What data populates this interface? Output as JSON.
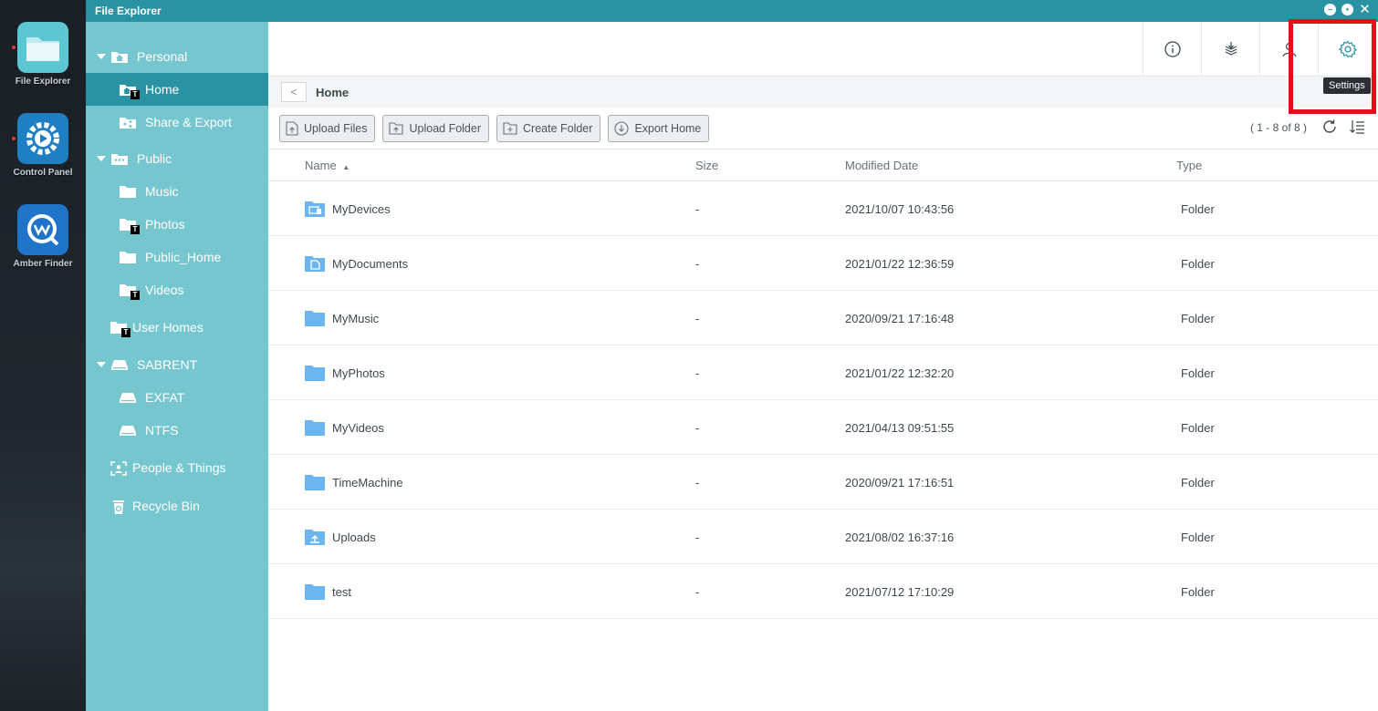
{
  "dock": {
    "apps": [
      {
        "label": "File Explorer",
        "icon": "file-explorer-icon"
      },
      {
        "label": "Control Panel",
        "icon": "control-panel-icon"
      },
      {
        "label": "Amber Finder",
        "icon": "amber-finder-icon"
      }
    ]
  },
  "window": {
    "title": "File Explorer",
    "controls": [
      "minimize",
      "restore",
      "close"
    ]
  },
  "sidebar": {
    "items": [
      {
        "label": "Personal",
        "level": 0,
        "expanded": true,
        "icon": "home-folder-icon"
      },
      {
        "label": "Home",
        "level": 1,
        "selected": true,
        "badge": "T",
        "icon": "folder-icon"
      },
      {
        "label": "Share & Export",
        "level": 1,
        "icon": "share-icon"
      },
      {
        "label": "Public",
        "level": 0,
        "expanded": true,
        "icon": "public-icon"
      },
      {
        "label": "Music",
        "level": 1,
        "icon": "folder-icon"
      },
      {
        "label": "Photos",
        "level": 1,
        "badge": "T",
        "icon": "folder-icon"
      },
      {
        "label": "Public_Home",
        "level": 1,
        "icon": "folder-icon"
      },
      {
        "label": "Videos",
        "level": 1,
        "badge": "T",
        "icon": "folder-icon"
      },
      {
        "label": "User Homes",
        "level": 0,
        "badge": "T",
        "icon": "folder-icon"
      },
      {
        "label": "SABRENT",
        "level": 0,
        "expanded": true,
        "icon": "drive-icon"
      },
      {
        "label": "EXFAT",
        "level": 1,
        "icon": "drive-icon"
      },
      {
        "label": "NTFS",
        "level": 1,
        "icon": "drive-icon"
      },
      {
        "label": "People & Things",
        "level": 0,
        "icon": "face-scan-icon"
      },
      {
        "label": "Recycle Bin",
        "level": 0,
        "icon": "recycle-bin-icon"
      }
    ]
  },
  "toolbar": {
    "buttons": [
      {
        "icon": "info-icon"
      },
      {
        "icon": "tasks-icon"
      },
      {
        "icon": "user-icon"
      },
      {
        "icon": "gear-icon"
      }
    ],
    "tooltip": "Settings"
  },
  "path": {
    "current": "Home"
  },
  "actions": {
    "upload_files": "Upload Files",
    "upload_folder": "Upload Folder",
    "create_folder": "Create Folder",
    "export_home": "Export Home",
    "count": "( 1 - 8 of 8 )"
  },
  "table": {
    "columns": {
      "name": "Name",
      "size": "Size",
      "modified": "Modified Date",
      "type": "Type"
    },
    "sort_column": "Name",
    "sort_direction": "ascending",
    "rows": [
      {
        "name": "MyDevices",
        "size": "-",
        "modified": "2021/10/07 10:43:56",
        "type": "Folder",
        "icon": "devices-folder-icon"
      },
      {
        "name": "MyDocuments",
        "size": "-",
        "modified": "2021/01/22 12:36:59",
        "type": "Folder",
        "icon": "documents-folder-icon"
      },
      {
        "name": "MyMusic",
        "size": "-",
        "modified": "2020/09/21 17:16:48",
        "type": "Folder",
        "icon": "folder-icon"
      },
      {
        "name": "MyPhotos",
        "size": "-",
        "modified": "2021/01/22 12:32:20",
        "type": "Folder",
        "icon": "folder-icon"
      },
      {
        "name": "MyVideos",
        "size": "-",
        "modified": "2021/04/13 09:51:55",
        "type": "Folder",
        "icon": "folder-icon"
      },
      {
        "name": "TimeMachine",
        "size": "-",
        "modified": "2020/09/21 17:16:51",
        "type": "Folder",
        "icon": "folder-icon"
      },
      {
        "name": "Uploads",
        "size": "-",
        "modified": "2021/08/02 16:37:16",
        "type": "Folder",
        "icon": "upload-folder-icon"
      },
      {
        "name": "test",
        "size": "-",
        "modified": "2021/07/12 17:10:29",
        "type": "Folder",
        "icon": "folder-icon"
      }
    ]
  },
  "colors": {
    "accent": "#2a93a3",
    "sidebar": "#76c6d0",
    "folder": "#6bb5f0",
    "highlight": "#e3101c"
  }
}
